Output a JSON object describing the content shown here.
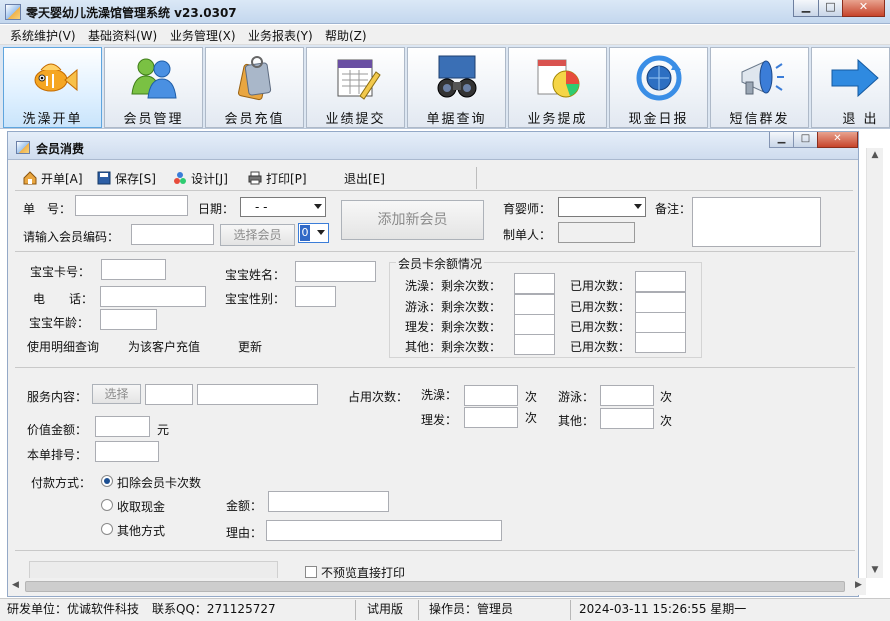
{
  "window": {
    "title": "零天婴幼儿洗澡馆管理系统  v23.0307",
    "minimize": "▁",
    "maximize": "□",
    "close": "✕"
  },
  "menu": [
    "系统维护(V)",
    "基础资料(W)",
    "业务管理(X)",
    "业务报表(Y)",
    "帮助(Z)"
  ],
  "toolbar": [
    {
      "label": "洗澡开单",
      "icon": "fish-icon",
      "active": true
    },
    {
      "label": "会员管理",
      "icon": "users-icon"
    },
    {
      "label": "会员充值",
      "icon": "tag-icon"
    },
    {
      "label": "业绩提交",
      "icon": "calendar-edit-icon"
    },
    {
      "label": "单据查询",
      "icon": "binoculars-icon"
    },
    {
      "label": "业务提成",
      "icon": "pie-chart-icon"
    },
    {
      "label": "现金日报",
      "icon": "globe-refresh-icon"
    },
    {
      "label": "短信群发",
      "icon": "megaphone-icon"
    },
    {
      "label": "退 出",
      "icon": "arrow-right-icon"
    }
  ],
  "child_window": {
    "title": "会员消费",
    "buttons": {
      "minimize": "▁",
      "maximize": "□",
      "close": "✕"
    }
  },
  "sub_toolbar": [
    {
      "label": "开单[A]",
      "icon": "house-icon"
    },
    {
      "label": "保存[S]",
      "icon": "disk-icon"
    },
    {
      "label": "设计[J]",
      "icon": "design-icon"
    },
    {
      "label": "打印[P]",
      "icon": "printer-icon"
    },
    {
      "label": "退出[E]",
      "icon": ""
    }
  ],
  "header_form": {
    "order_no_label": "单　号：",
    "order_no_value": "",
    "date_label": "日期：",
    "date_value": "  -  -",
    "add_member_button": "添加新会员",
    "nurse_label": "育婴师：",
    "nurse_value": "",
    "remark_label": "备注：",
    "remark_value": "",
    "member_code_label": "请输入会员编码：",
    "member_code_value": "",
    "select_member_button": "选择会员",
    "combo_value": "0",
    "maker_label": "制单人：",
    "maker_value": ""
  },
  "baby_info": {
    "card_no_label": "宝宝卡号：",
    "card_no_value": "",
    "name_label": "宝宝姓名：",
    "name_value": "",
    "phone_label": "电　　话：",
    "phone_value": "",
    "gender_label": "宝宝性别：",
    "gender_value": "",
    "age_label": "宝宝年龄：",
    "age_value": "",
    "link_detail": "使用明细查询",
    "link_recharge": "为该客户充值",
    "link_refresh": "更新"
  },
  "balance": {
    "legend": "会员卡余额情况",
    "rows": [
      {
        "label": "洗澡：剩余次数：",
        "remaining": "",
        "used_label": "已用次数：",
        "used": ""
      },
      {
        "label": "游泳：剩余次数：",
        "remaining": "",
        "used_label": "已用次数：",
        "used": ""
      },
      {
        "label": "理发：剩余次数：",
        "remaining": "",
        "used_label": "已用次数：",
        "used": ""
      },
      {
        "label": "其他：剩余次数：",
        "remaining": "",
        "used_label": "已用次数：",
        "used": ""
      }
    ]
  },
  "service": {
    "content_label": "服务内容：",
    "select_button": "选择",
    "value_amount_label": "价值金额：",
    "value_amount_unit": "元",
    "sort_no_label": "本单排号：",
    "occupy_label": "占用次数：",
    "bath_label": "洗澡：",
    "swim_label": "游泳：",
    "haircut_label": "理发：",
    "other_label": "其他：",
    "times_unit": "次",
    "payment_label": "付款方式：",
    "payment_options": [
      "扣除会员卡次数",
      "收取现金",
      "其他方式"
    ],
    "payment_selected": 0,
    "amount_label": "金额：",
    "reason_label": "理由：",
    "no_preview_print": "不预览直接打印"
  },
  "statusbar": {
    "developer": "研发单位：优诚软件科技",
    "contact": "联系QQ：271125727",
    "edition": "试用版",
    "operator": "操作员：管理员",
    "datetime": "2024-03-11 15:26:55 星期一"
  }
}
